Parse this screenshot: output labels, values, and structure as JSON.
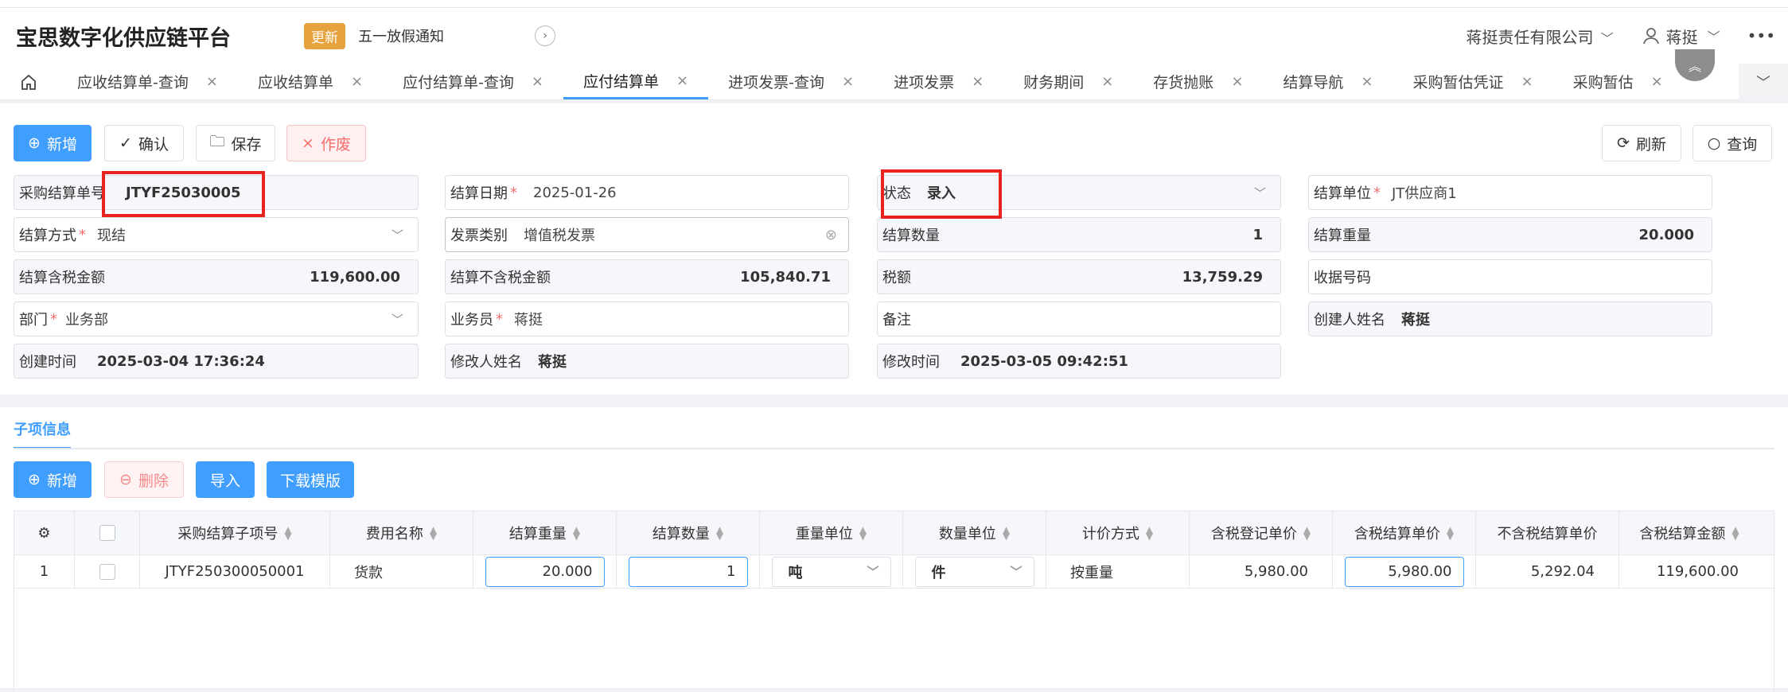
{
  "app": {
    "title": "宝思数字化供应链平台"
  },
  "notice": {
    "badge": "更新",
    "text": "五一放假通知"
  },
  "header": {
    "company": "蒋挺责任有限公司",
    "user": "蒋挺",
    "more": "•••"
  },
  "tabs": [
    {
      "label": "应收结算单-查询"
    },
    {
      "label": "应收结算单"
    },
    {
      "label": "应付结算单-查询"
    },
    {
      "label": "应付结算单",
      "active": true
    },
    {
      "label": "进项发票-查询"
    },
    {
      "label": "进项发票"
    },
    {
      "label": "财务期间"
    },
    {
      "label": "存货抛账"
    },
    {
      "label": "结算导航"
    },
    {
      "label": "采购暂估凭证"
    },
    {
      "label": "采购暂估"
    }
  ],
  "toolbar": {
    "add": "新增",
    "confirm": "确认",
    "save": "保存",
    "void": "作废",
    "refresh": "刷新",
    "query": "查询"
  },
  "form": {
    "bill_no": {
      "label": "采购结算单号",
      "value": "JTYF25030005"
    },
    "settle_date": {
      "label": "结算日期",
      "value": "2025-01-26"
    },
    "status": {
      "label": "状态",
      "value": "录入"
    },
    "settle_unit": {
      "label": "结算单位",
      "value": "JT供应商1"
    },
    "settle_method": {
      "label": "结算方式",
      "value": "现结"
    },
    "invoice_type": {
      "label": "发票类别",
      "value": "增值税发票"
    },
    "settle_qty": {
      "label": "结算数量",
      "value": "1"
    },
    "settle_weight": {
      "label": "结算重量",
      "value": "20.000"
    },
    "amount_tax": {
      "label": "结算含税金额",
      "value": "119,600.00"
    },
    "amount_notax": {
      "label": "结算不含税金额",
      "value": "105,840.71"
    },
    "tax": {
      "label": "税额",
      "value": "13,759.29"
    },
    "receipt_no": {
      "label": "收据号码",
      "value": ""
    },
    "dept": {
      "label": "部门",
      "value": "业务部"
    },
    "salesman": {
      "label": "业务员",
      "value": "蒋挺"
    },
    "remark": {
      "label": "备注",
      "value": ""
    },
    "creator": {
      "label": "创建人姓名",
      "value": "蒋挺"
    },
    "created_at": {
      "label": "创建时间",
      "value": "2025-03-04 17:36:24"
    },
    "modifier": {
      "label": "修改人姓名",
      "value": "蒋挺"
    },
    "modified_at": {
      "label": "修改时间",
      "value": "2025-03-05 09:42:51"
    }
  },
  "sub": {
    "tab": "子项信息",
    "add": "新增",
    "delete": "删除",
    "import": "导入",
    "download": "下载模版",
    "columns": [
      "采购结算子项号",
      "费用名称",
      "结算重量",
      "结算数量",
      "重量单位",
      "数量单位",
      "计价方式",
      "含税登记单价",
      "含税结算单价",
      "不含税结算单价",
      "含税结算金额"
    ],
    "rows": [
      {
        "idx": "1",
        "item_no": "JTYF250300050001",
        "fee_name": "货款",
        "weight": "20.000",
        "qty": "1",
        "weight_unit": "吨",
        "qty_unit": "件",
        "price_mode": "按重量",
        "reg_price": "5,980.00",
        "settle_price": "5,980.00",
        "notax_price": "5,292.04",
        "amount": "119,600.00"
      }
    ]
  },
  "colors": {
    "primary": "#409eff",
    "danger": "#f56c6c",
    "highlight": "#e8231f",
    "badge": "#e6a23c"
  }
}
